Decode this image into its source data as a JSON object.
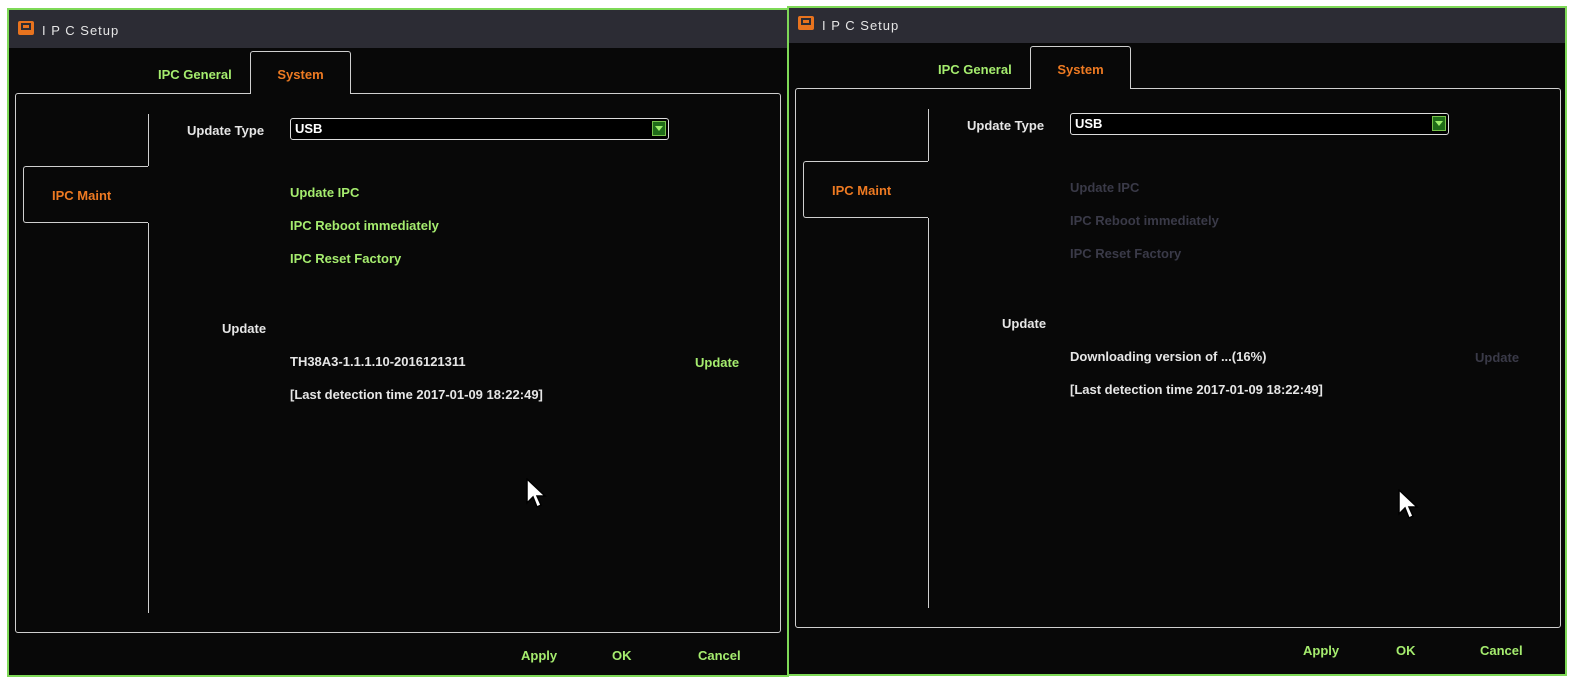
{
  "windows": [
    {
      "title": "I P C  Setup",
      "tabs": {
        "general": "IPC General",
        "system": "System"
      },
      "side_tab": "IPC Maint",
      "update_type_label": "Update Type",
      "update_type_value": "USB",
      "actions": {
        "update_ipc": "Update IPC",
        "reboot": "IPC Reboot immediately",
        "reset": "IPC Reset Factory",
        "enabled": true
      },
      "update_label": "Update",
      "version_text": "TH38A3-1.1.1.10-2016121311",
      "detection_text": "[Last detection time 2017-01-09 18:22:49]",
      "update_button": "Update",
      "footer": {
        "apply": "Apply",
        "ok": "OK",
        "cancel": "Cancel"
      }
    },
    {
      "title": "I P C  Setup",
      "tabs": {
        "general": "IPC General",
        "system": "System"
      },
      "side_tab": "IPC Maint",
      "update_type_label": "Update Type",
      "update_type_value": "USB",
      "actions": {
        "update_ipc": "Update IPC",
        "reboot": "IPC Reboot immediately",
        "reset": "IPC Reset Factory",
        "enabled": false
      },
      "update_label": "Update",
      "version_text": "Downloading version of ...(16%)",
      "download_progress": 16,
      "detection_text": "[Last detection time 2017-01-09 18:22:49]",
      "update_button": "Update",
      "footer": {
        "apply": "Apply",
        "ok": "OK",
        "cancel": "Cancel"
      }
    }
  ],
  "icons": {
    "title": "monitor-icon",
    "dropdown": "chevron-down-icon",
    "cursor": "mouse-pointer-icon"
  },
  "colors": {
    "accent": "#ee7a22",
    "action": "#a5ec6e",
    "disabled": "#3a3a48",
    "frame": "#7ed957"
  }
}
